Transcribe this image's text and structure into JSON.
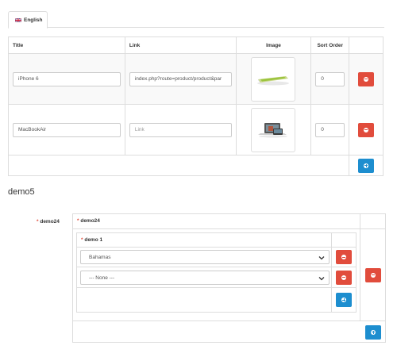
{
  "language_tab": {
    "label": "English",
    "icon": "flag-uk-icon"
  },
  "slides_table": {
    "columns": [
      "Title",
      "Link",
      "Image",
      "Sort Order"
    ],
    "rows": [
      {
        "title": "iPhone 6",
        "link": "index.php?route=product/product&par",
        "image": "iphone-thumbnail",
        "sort_order": "0"
      },
      {
        "title": "MacBookAir",
        "link_placeholder": "Link",
        "image": "macbook-thumbnail",
        "sort_order": "0"
      }
    ]
  },
  "section": {
    "title": "demo5"
  },
  "group": {
    "label": "demo24",
    "header": "demo24",
    "sub_header": "demo 1",
    "selects": [
      "Bahamas",
      "--- None ---"
    ]
  },
  "colors": {
    "danger": "#e14c3c",
    "primary": "#1d8ecf"
  }
}
